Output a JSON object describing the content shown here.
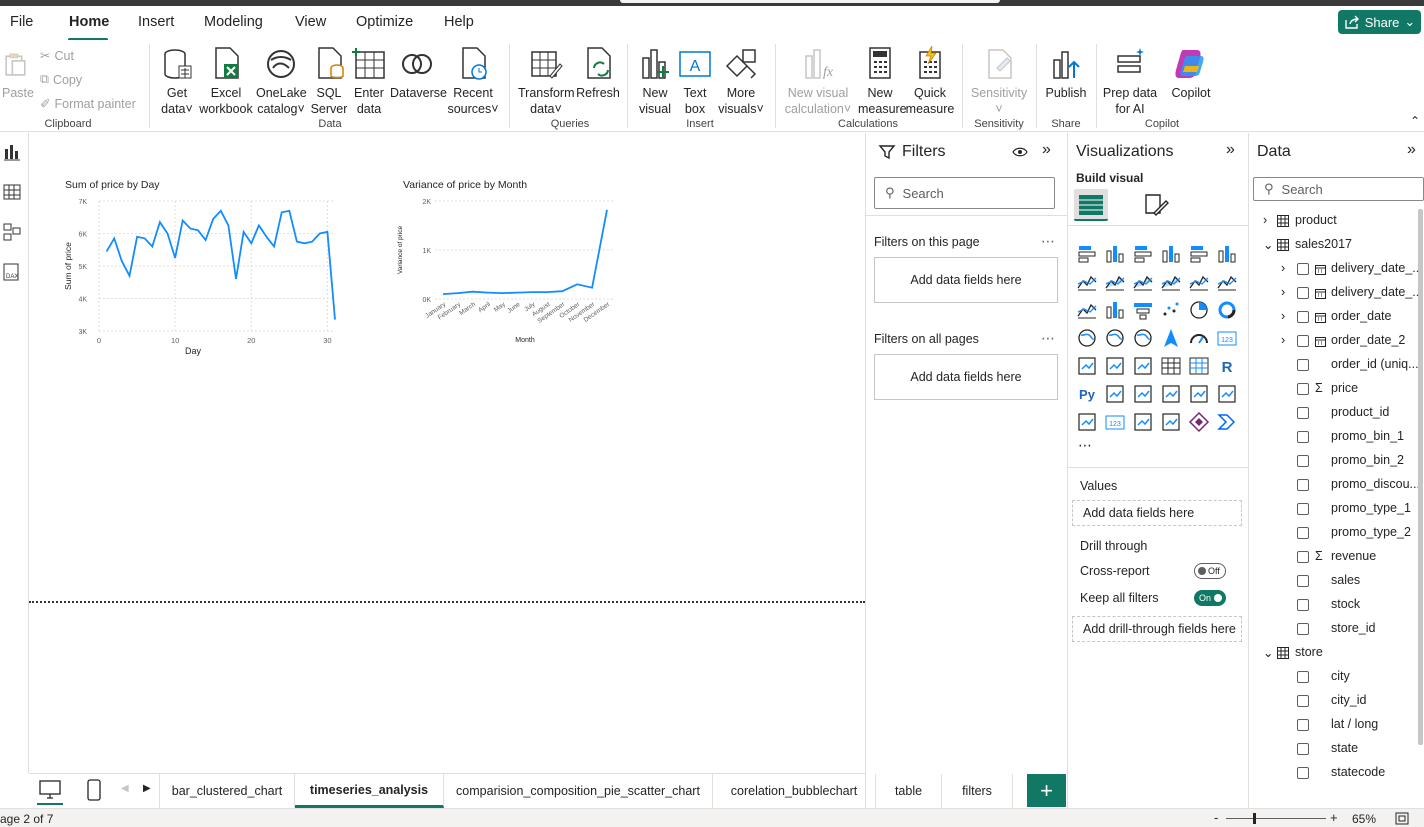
{
  "menu": [
    "File",
    "Home",
    "Insert",
    "Modeling",
    "View",
    "Optimize",
    "Help"
  ],
  "share_label": "Share",
  "ribbon": {
    "clipboard": {
      "paste": "Paste",
      "cut": "Cut",
      "copy": "Copy",
      "format_painter": "Format painter",
      "group": "Clipboard"
    },
    "data": {
      "get_data": "Get data",
      "excel": "Excel workbook",
      "onelake": "OneLake catalog",
      "sql": "SQL Server",
      "enter": "Enter data",
      "dataverse": "Dataverse",
      "recent": "Recent sources",
      "group": "Data"
    },
    "queries": {
      "transform": "Transform data",
      "refresh": "Refresh",
      "group": "Queries"
    },
    "insert": {
      "new_visual": "New visual",
      "text_box": "Text box",
      "more_visuals": "More visuals",
      "group": "Insert"
    },
    "calculations": {
      "new_visual_calc": "New visual calculation",
      "new_measure": "New measure",
      "quick_measure": "Quick measure",
      "group": "Calculations"
    },
    "sensitivity": {
      "label": "Sensitivity",
      "group": "Sensitivity"
    },
    "share": {
      "publish": "Publish",
      "group": "Share"
    },
    "copilot": {
      "prep": "Prep data for AI",
      "copilot": "Copilot",
      "group": "Copilot"
    }
  },
  "chart_data": [
    {
      "type": "line",
      "title": "Sum of price by Day",
      "xlabel": "Day",
      "ylabel": "Sum of price",
      "xlim": [
        0,
        31
      ],
      "ylim": [
        3000,
        7000
      ],
      "x_ticks": [
        "0",
        "10",
        "20",
        "30"
      ],
      "y_ticks": [
        "3K",
        "4K",
        "5K",
        "6K",
        "7K"
      ],
      "color": "#118dff",
      "x": [
        1,
        2,
        3,
        4,
        5,
        6,
        7,
        8,
        9,
        10,
        11,
        12,
        13,
        14,
        15,
        16,
        17,
        18,
        19,
        20,
        21,
        22,
        23,
        24,
        25,
        26,
        27,
        28,
        29,
        30,
        31
      ],
      "values": [
        5450,
        5850,
        5150,
        4700,
        5900,
        5850,
        5600,
        6350,
        6000,
        5250,
        6400,
        6150,
        6100,
        5800,
        6450,
        6700,
        6250,
        4600,
        6050,
        5700,
        6250,
        5900,
        5600,
        6650,
        6700,
        5750,
        5700,
        5750,
        6000,
        6050,
        3350
      ]
    },
    {
      "type": "line",
      "title": "Variance of price by Month",
      "xlabel": "Month",
      "ylabel": "Variance of price",
      "ylim": [
        0,
        2000
      ],
      "y_ticks": [
        "0K",
        "1K",
        "2K"
      ],
      "color": "#118dff",
      "categories": [
        "January",
        "February",
        "March",
        "April",
        "May",
        "June",
        "July",
        "August",
        "September",
        "October",
        "November",
        "December"
      ],
      "values": [
        100,
        120,
        150,
        130,
        120,
        130,
        140,
        140,
        160,
        300,
        230,
        1820
      ]
    }
  ],
  "filters": {
    "title": "Filters",
    "search": "Search",
    "on_page": "Filters on this page",
    "on_all": "Filters on all pages",
    "add": "Add data fields here"
  },
  "visualizations": {
    "title": "Visualizations",
    "build": "Build visual",
    "values": "Values",
    "values_add": "Add data fields here",
    "drill": "Drill through",
    "cross": "Cross-report",
    "cross_state": "Off",
    "keep": "Keep all filters",
    "keep_state": "On",
    "drill_add": "Add drill-through fields here"
  },
  "data_pane": {
    "title": "Data",
    "search": "Search",
    "tables": [
      {
        "name": "product"
      },
      {
        "name": "sales2017"
      },
      {
        "name": "store"
      }
    ],
    "sales_fields": [
      "delivery_date_...",
      "delivery_date_...",
      "order_date",
      "order_date_2",
      "order_id (uniq...",
      "price",
      "product_id",
      "promo_bin_1",
      "promo_bin_2",
      "promo_discou...",
      "promo_type_1",
      "promo_type_2",
      "revenue",
      "sales",
      "stock",
      "store_id"
    ],
    "store_fields": [
      "city",
      "city_id",
      "lat / long",
      "state",
      "statecode",
      "store_id"
    ]
  },
  "tabs": [
    "bar_clustered_chart",
    "timeseries_analysis",
    "comparision_composition_pie_scatter_chart",
    "corelation_bubblechart",
    "table",
    "filters"
  ],
  "status": {
    "page": "age 2 of 7",
    "zoom": "65%"
  }
}
